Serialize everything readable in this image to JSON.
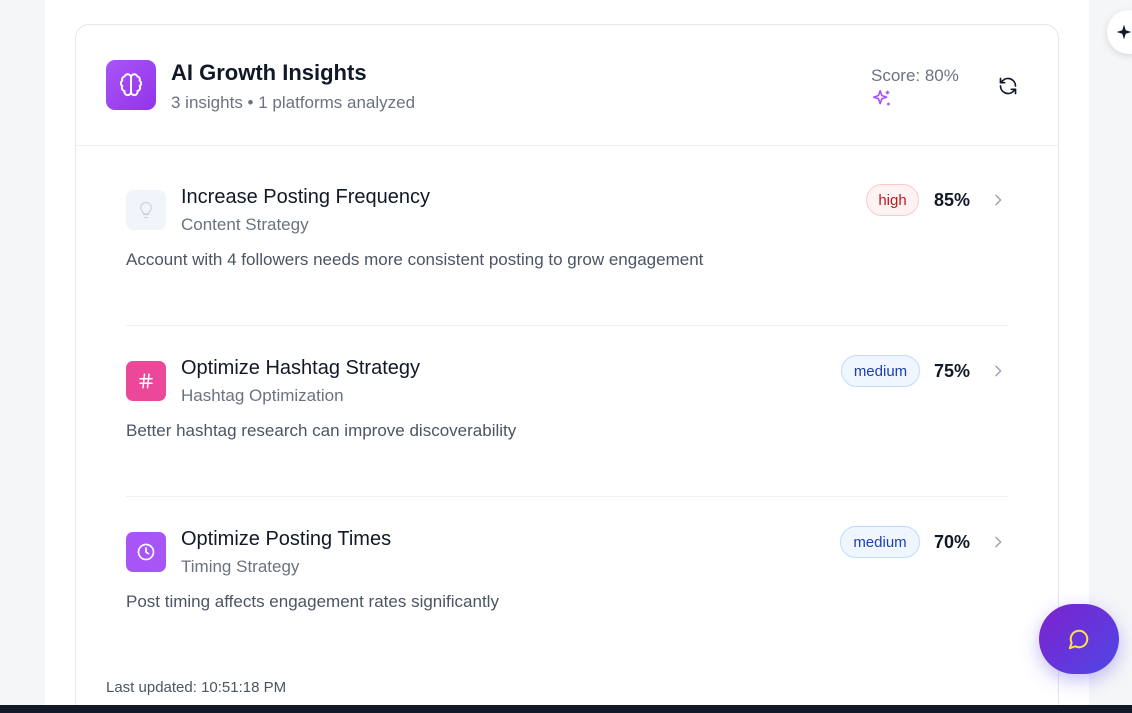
{
  "header": {
    "title": "AI Growth Insights",
    "subtitle": "3 insights • 1 platforms analyzed",
    "score": "Score: 80%",
    "brain_icon": "brain-icon",
    "refresh_icon": "refresh-icon",
    "sparkle_icon": "sparkles-icon"
  },
  "insights": [
    {
      "title": "Increase Posting Frequency",
      "category": "Content Strategy",
      "description": "Account with 4 followers needs more consistent posting to grow engagement",
      "priority": "high",
      "confidence": "85%",
      "icon": "lightbulb-icon"
    },
    {
      "title": "Optimize Hashtag Strategy",
      "category": "Hashtag Optimization",
      "description": "Better hashtag research can improve discoverability",
      "priority": "medium",
      "confidence": "75%",
      "icon": "hashtag-icon"
    },
    {
      "title": "Optimize Posting Times",
      "category": "Timing Strategy",
      "description": "Post timing affects engagement rates significantly",
      "priority": "medium",
      "confidence": "70%",
      "icon": "clock-icon"
    }
  ],
  "footer": {
    "last_updated": "Last updated: 10:51:18 PM"
  },
  "colors": {
    "accent_purple": "#9333ea",
    "pink": "#ec4899",
    "high_badge": "#b91c1c",
    "medium_badge": "#1e40af"
  },
  "fab": {
    "icon": "chat-bubble-icon"
  },
  "side_button": {
    "icon": "sparkle-star-icon"
  }
}
